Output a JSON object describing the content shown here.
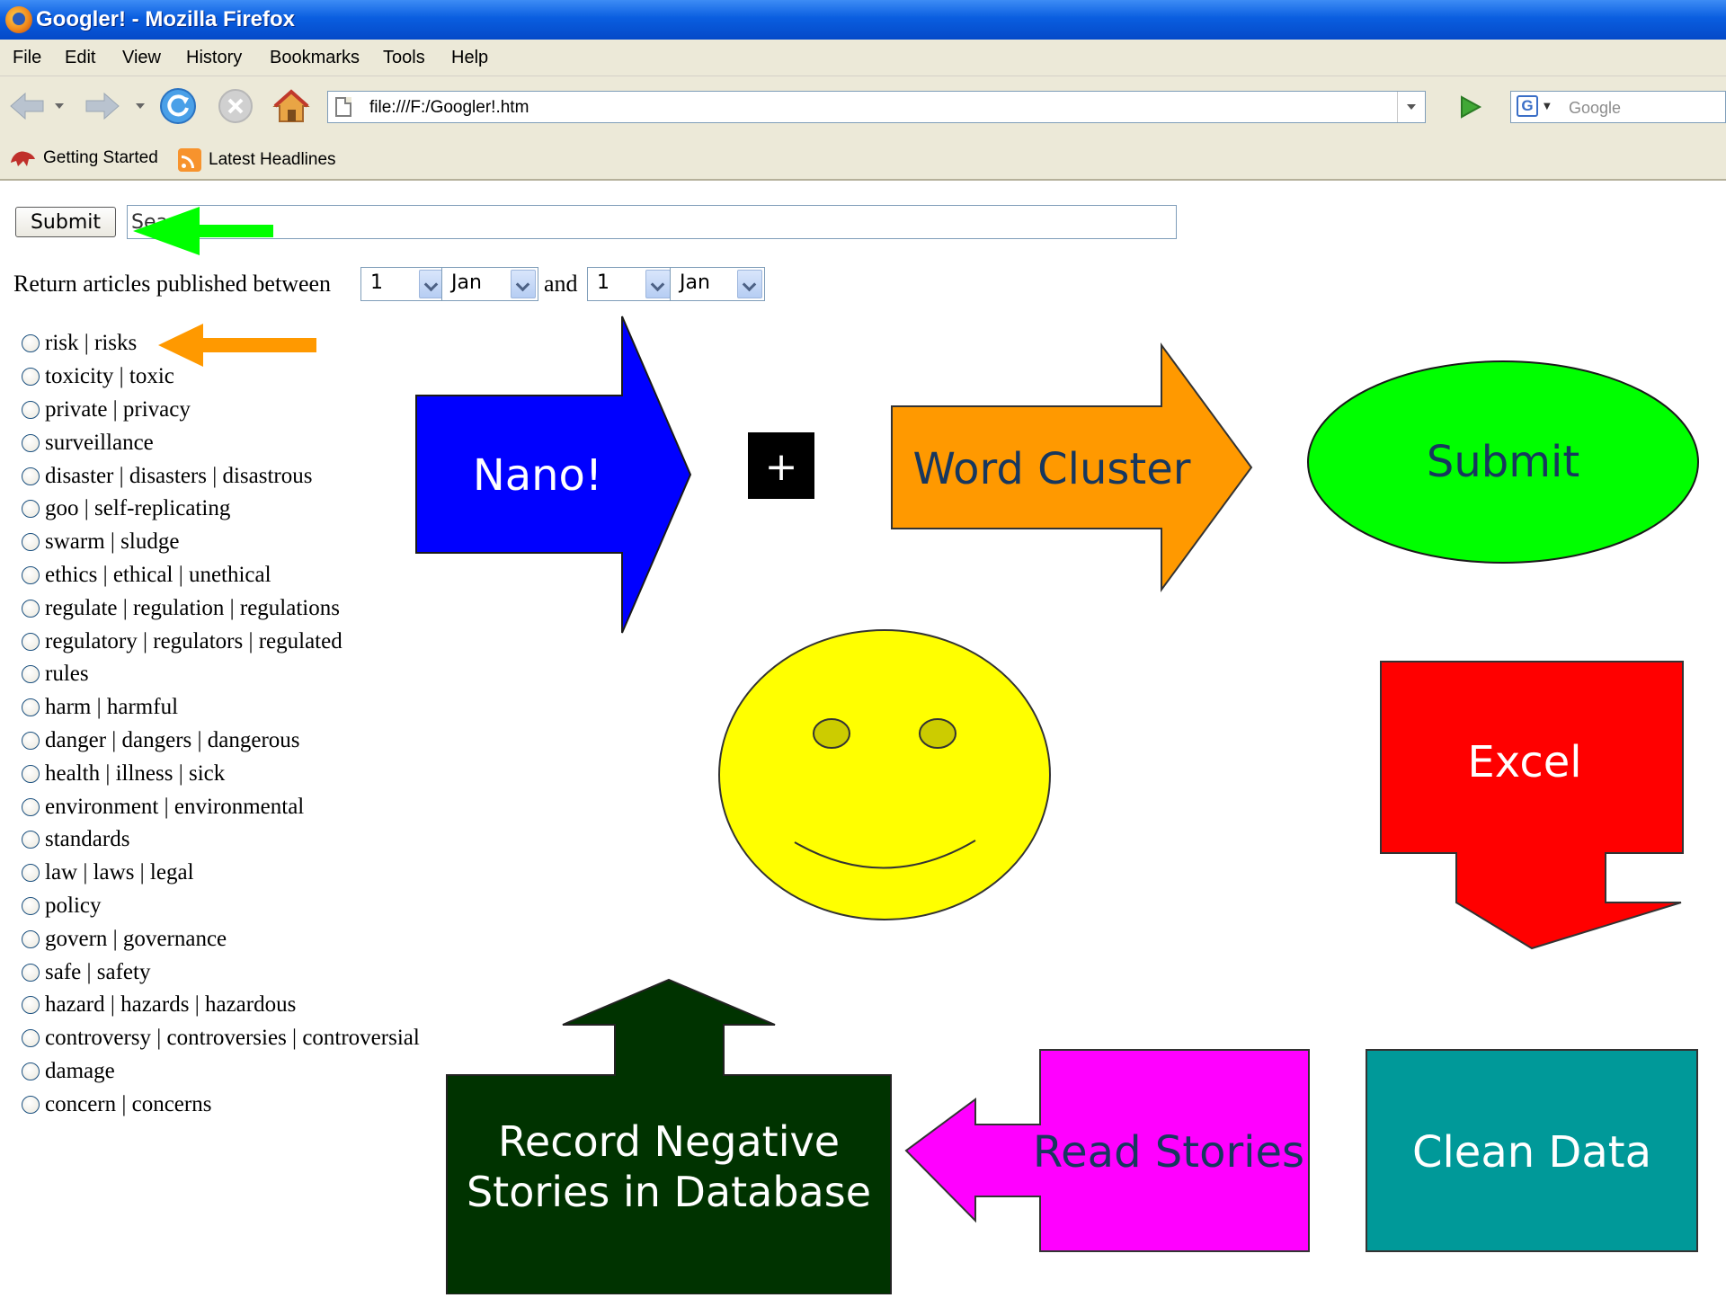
{
  "window": {
    "title": "Googler! - Mozilla Firefox"
  },
  "menu": {
    "items": [
      "File",
      "Edit",
      "View",
      "History",
      "Bookmarks",
      "Tools",
      "Help"
    ]
  },
  "navigation": {
    "url": "file:///F:/Googler!.htm",
    "search_engine_placeholder": "Google",
    "icons": [
      "back-icon",
      "forward-icon",
      "reload-icon",
      "stop-icon",
      "home-icon",
      "page-icon",
      "go-icon",
      "google-icon"
    ]
  },
  "bookmarks": {
    "items": [
      {
        "label": "Getting Started",
        "icon": "getting-started-icon"
      },
      {
        "label": "Latest Headlines",
        "icon": "rss-feed-icon"
      }
    ]
  },
  "form": {
    "submit_label": "Submit",
    "search_value": "Search",
    "date_prefix": "Return articles published between",
    "date_conjunction": "and",
    "from_day": "1",
    "from_month": "Jan",
    "to_day": "1",
    "to_month": "Jan"
  },
  "keywords": [
    "risk | risks",
    "toxicity | toxic",
    "private | privacy",
    "surveillance",
    "disaster | disasters | disastrous",
    "goo | self-replicating",
    "swarm | sludge",
    "ethics | ethical | unethical",
    "regulate | regulation | regulations",
    "regulatory | regulators | regulated",
    "rules",
    "harm | harmful",
    "danger | dangers | dangerous",
    "health | illness | sick",
    "environment | environmental",
    "standards",
    "law | laws | legal",
    "policy",
    "govern | governance",
    "safe | safety",
    "hazard | hazards | hazardous",
    "controversy | controversies | controversial",
    "damage",
    "concern | concerns"
  ],
  "diagram": {
    "nano_label": "Nano!",
    "plus_label": "+",
    "word_cluster_label": "Word Cluster",
    "submit_label": "Submit",
    "excel_label": "Excel",
    "clean_data_label": "Clean Data",
    "read_stories_label": "Read Stories",
    "record_line1": "Record Negative",
    "record_line2": "Stories in Database",
    "colors": {
      "nano": "#0000ff",
      "word_cluster": "#ff9900",
      "submit": "#00ff00",
      "excel": "#ff0000",
      "clean_data": "#009999",
      "read_stories": "#ff00ff",
      "record": "#003300",
      "smiley": "#ffff00",
      "pointer_green": "#00ff00",
      "pointer_orange": "#ff9900",
      "label_dark": "#17375e"
    }
  }
}
